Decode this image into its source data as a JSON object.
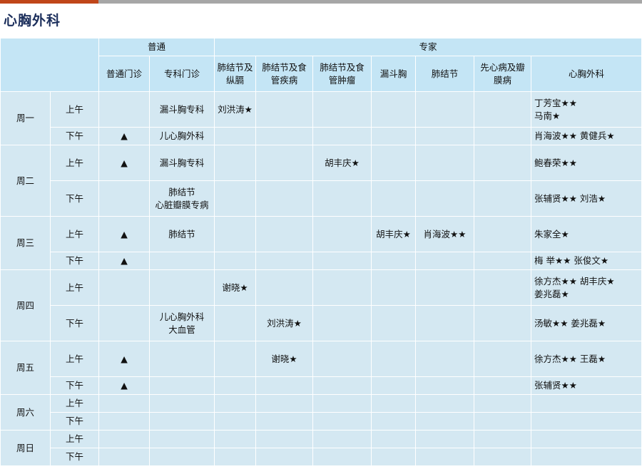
{
  "title": "心胸外科",
  "header": {
    "general_group": "普通",
    "expert_group": "专家",
    "columns": [
      "普通门诊",
      "专科门诊",
      "肺结节及\n纵膈",
      "肺结节及食\n管疾病",
      "肺结节及食\n管肿瘤",
      "漏斗胸",
      "肺结节",
      "先心病及瓣\n膜病",
      "心胸外科"
    ]
  },
  "days": [
    {
      "name": "周一",
      "slots": [
        {
          "period": "上午",
          "cells": [
            "",
            "漏斗胸专科",
            "刘洪涛★",
            "",
            "",
            "",
            "",
            "",
            "丁芳宝★★\n马南★"
          ]
        },
        {
          "period": "下午",
          "cells": [
            "▲",
            "儿心胸外科",
            "",
            "",
            "",
            "",
            "",
            "",
            "肖海波★★   黄健兵★"
          ]
        }
      ]
    },
    {
      "name": "周二",
      "slots": [
        {
          "period": "上午",
          "cells": [
            "▲",
            "漏斗胸专科",
            "",
            "",
            "胡丰庆★",
            "",
            "",
            "",
            "鲍春荣★★"
          ]
        },
        {
          "period": "下午",
          "cells": [
            "",
            "肺结节\n心脏瓣膜专病",
            "",
            "",
            "",
            "",
            "",
            "",
            "张辅贤★★   刘浩★"
          ]
        }
      ]
    },
    {
      "name": "周三",
      "slots": [
        {
          "period": "上午",
          "cells": [
            "▲",
            "肺结节",
            "",
            "",
            "",
            "胡丰庆★",
            "肖海波★★",
            "",
            "朱家全★"
          ]
        },
        {
          "period": "下午",
          "cells": [
            "▲",
            "",
            "",
            "",
            "",
            "",
            "",
            "",
            "梅   举★★    张俊文★"
          ]
        }
      ]
    },
    {
      "name": "周四",
      "slots": [
        {
          "period": "上午",
          "cells": [
            "",
            "",
            "谢晓★",
            "",
            "",
            "",
            "",
            "",
            "徐方杰★★    胡丰庆★\n姜兆磊★"
          ]
        },
        {
          "period": "下午",
          "cells": [
            "",
            "儿心胸外科\n大血管",
            "",
            "刘洪涛★",
            "",
            "",
            "",
            "",
            "汤敏★★    姜兆磊★"
          ]
        }
      ]
    },
    {
      "name": "周五",
      "slots": [
        {
          "period": "上午",
          "cells": [
            "▲",
            "",
            "",
            "谢晓★",
            "",
            "",
            "",
            "",
            "徐方杰★★    王磊★"
          ]
        },
        {
          "period": "下午",
          "cells": [
            "▲",
            "",
            "",
            "",
            "",
            "",
            "",
            "",
            "张辅贤★★"
          ]
        }
      ]
    },
    {
      "name": "周六",
      "slots": [
        {
          "period": "上午",
          "cells": [
            "",
            "",
            "",
            "",
            "",
            "",
            "",
            "",
            ""
          ]
        },
        {
          "period": "下午",
          "cells": [
            "",
            "",
            "",
            "",
            "",
            "",
            "",
            "",
            ""
          ]
        }
      ]
    },
    {
      "name": "周日",
      "slots": [
        {
          "period": "上午",
          "cells": [
            "",
            "",
            "",
            "",
            "",
            "",
            "",
            "",
            ""
          ]
        },
        {
          "period": "下午",
          "cells": [
            "",
            "",
            "",
            "",
            "",
            "",
            "",
            "",
            ""
          ]
        }
      ]
    }
  ]
}
